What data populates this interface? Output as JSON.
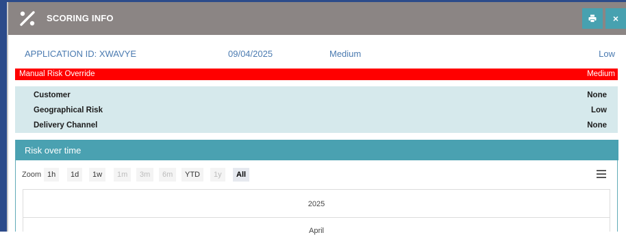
{
  "window": {
    "title": "SCORING INFO",
    "icon": "percent-icon",
    "print_icon": "print-icon",
    "close_label": "×"
  },
  "application": {
    "id_label": "APPLICATION ID: XWAVYE",
    "date": "09/04/2025",
    "risk_level": "Medium",
    "risk_result": "Low"
  },
  "override": {
    "label": "Manual Risk Override",
    "value": "Medium",
    "color": "#ff0000"
  },
  "factors": [
    {
      "name": "Customer",
      "value": "None"
    },
    {
      "name": "Geographical Risk",
      "value": "Low"
    },
    {
      "name": "Delivery Channel",
      "value": "None"
    }
  ],
  "chart_panel": {
    "title": "Risk over time",
    "zoom_label": "Zoom",
    "zoom_buttons": [
      {
        "label": "1h",
        "state": "enabled"
      },
      {
        "label": "1d",
        "state": "enabled"
      },
      {
        "label": "1w",
        "state": "enabled"
      },
      {
        "label": "1m",
        "state": "disabled"
      },
      {
        "label": "3m",
        "state": "disabled"
      },
      {
        "label": "6m",
        "state": "disabled"
      },
      {
        "label": "YTD",
        "state": "enabled"
      },
      {
        "label": "1y",
        "state": "disabled"
      },
      {
        "label": "All",
        "state": "selected"
      }
    ],
    "menu_icon": "hamburger-menu-icon",
    "timeline_year": "2025",
    "timeline_month": "April"
  },
  "colors": {
    "titlebar": "#8b8584",
    "accent": "#47a1b0",
    "factor_bg": "#d6e9ec",
    "link_text": "#4a7ab0"
  }
}
